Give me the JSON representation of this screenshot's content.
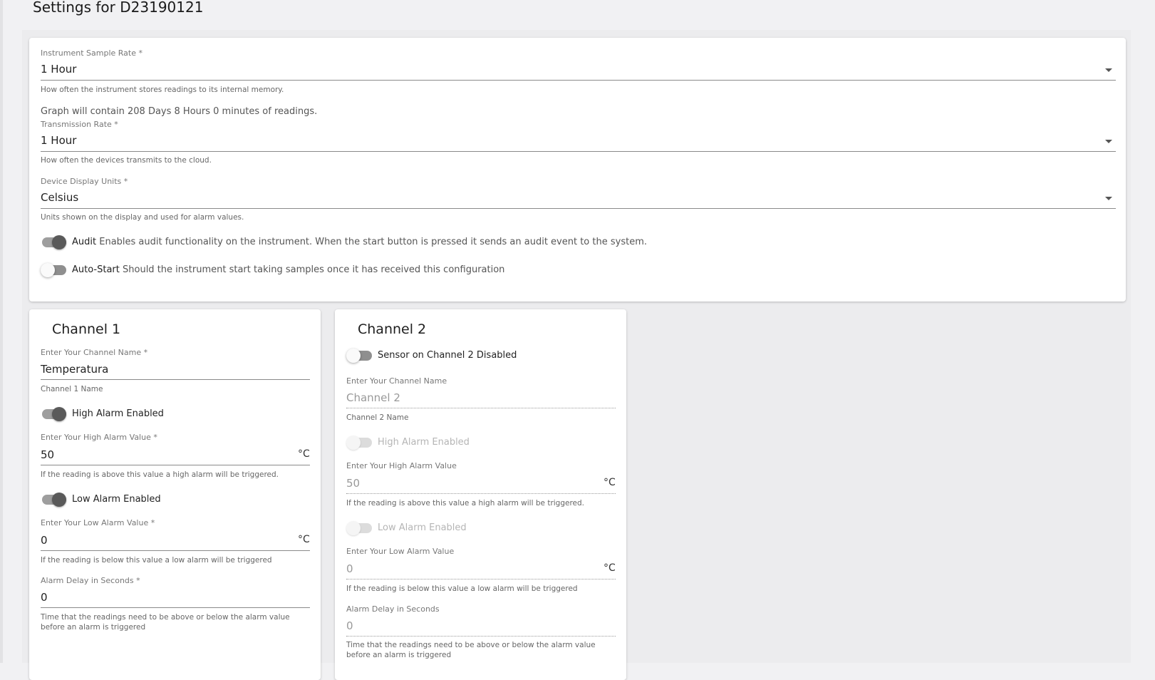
{
  "page": {
    "title": "Settings for D23190121"
  },
  "general": {
    "sample_rate": {
      "label": "Instrument Sample Rate *",
      "value": "1 Hour",
      "helper": "How often the instrument stores readings to its internal memory."
    },
    "graph_info": "Graph will contain 208 Days 8 Hours 0 minutes of readings.",
    "transmission_rate": {
      "label": "Transmission Rate *",
      "value": "1 Hour",
      "helper": "How often the devices transmits to the cloud."
    },
    "display_units": {
      "label": "Device Display Units *",
      "value": "Celsius",
      "helper": "Units shown on the display and used for alarm values."
    },
    "audit": {
      "name": "Audit",
      "description": "Enables audit functionality on the instrument. When the start button is pressed it sends an audit event to the system.",
      "enabled": true
    },
    "auto_start": {
      "name": "Auto-Start",
      "description": "Should the instrument start taking samples once it has received this configuration",
      "enabled": false
    }
  },
  "channel1": {
    "title": "Channel 1",
    "name_label": "Enter Your Channel Name *",
    "name_value": "Temperatura",
    "name_helper": "Channel 1 Name",
    "high_alarm_toggle": "High Alarm Enabled",
    "high_alarm_enabled": true,
    "high_label": "Enter Your High Alarm Value *",
    "high_value": "50",
    "high_unit": "°C",
    "high_helper": "If the reading is above this value a high alarm will be triggered.",
    "low_alarm_toggle": "Low Alarm Enabled",
    "low_alarm_enabled": true,
    "low_label": "Enter Your Low Alarm Value *",
    "low_value": "0",
    "low_unit": "°C",
    "low_helper": "If the reading is below this value a low alarm will be triggered",
    "delay_label": "Alarm Delay in Seconds *",
    "delay_value": "0",
    "delay_helper_1": "Time that the readings need to be above or below the alarm value",
    "delay_helper_2": "before an alarm is triggered"
  },
  "channel2": {
    "title": "Channel 2",
    "sensor_toggle": "Sensor on Channel 2 Disabled",
    "sensor_enabled": false,
    "name_label": "Enter Your Channel Name",
    "name_placeholder": "Channel 2",
    "name_helper": "Channel 2 Name",
    "high_alarm_toggle": "High Alarm Enabled",
    "high_label": "Enter Your High Alarm Value",
    "high_value": "50",
    "high_unit": "°C",
    "high_helper": "If the reading is above this value a high alarm will be triggered.",
    "low_alarm_toggle": "Low Alarm Enabled",
    "low_label": "Enter Your Low Alarm Value",
    "low_value": "0",
    "low_unit": "°C",
    "low_helper": "If the reading is below this value a low alarm will be triggered",
    "delay_label": "Alarm Delay in Seconds",
    "delay_value": "0",
    "delay_helper_1": "Time that the readings need to be above or below the alarm value",
    "delay_helper_2": "before an alarm is triggered"
  }
}
